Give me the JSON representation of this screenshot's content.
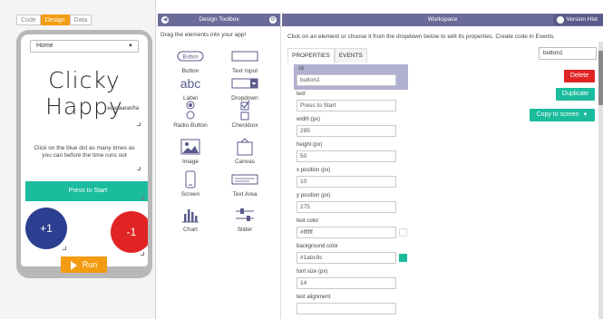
{
  "mode_tabs": [
    "Code",
    "Design",
    "Data"
  ],
  "screen": {
    "dropdown_value": "Home",
    "title": "Clicky Happy",
    "author": "ecasaarariha",
    "instructions": "Click on the blue dot as many times as you can before the time runs out",
    "start_button": "Press to Start",
    "blue_circle": "+1",
    "red_circle": "-1"
  },
  "run_button": "Run",
  "toolbox": {
    "header": "Design Toolbox",
    "hint": "Drag the elements into your app!",
    "items": [
      {
        "label": "Button",
        "icon": "button-icon",
        "glyph": "Button"
      },
      {
        "label": "Text Input",
        "icon": "text-input-icon"
      },
      {
        "label": "Label",
        "icon": "label-icon",
        "glyph": "abc"
      },
      {
        "label": "Dropdown",
        "icon": "dropdown-icon"
      },
      {
        "label": "Radio Button",
        "icon": "radio-button-icon"
      },
      {
        "label": "Checkbox",
        "icon": "checkbox-icon"
      },
      {
        "label": "Image",
        "icon": "image-icon"
      },
      {
        "label": "Canvas",
        "icon": "canvas-icon"
      },
      {
        "label": "Screen",
        "icon": "screen-icon"
      },
      {
        "label": "Text Area",
        "icon": "text-area-icon"
      },
      {
        "label": "Chart",
        "icon": "chart-icon"
      },
      {
        "label": "Slider",
        "icon": "slider-icon"
      }
    ]
  },
  "workspace": {
    "header": "Workspace",
    "version_button": "Version Hist",
    "hint": "Click on an element or choose it from the dropdown below to edit its properties. Create code in Events.",
    "tabs": [
      "PROPERTIES",
      "EVENTS"
    ],
    "element_select": "button1",
    "properties": [
      {
        "label": "id",
        "value": "button1"
      },
      {
        "label": "text",
        "value": "Press to Start"
      },
      {
        "label": "width (px)",
        "value": "295"
      },
      {
        "label": "height (px)",
        "value": "50"
      },
      {
        "label": "x position (px)",
        "value": "10"
      },
      {
        "label": "y position (px)",
        "value": "275"
      },
      {
        "label": "text color",
        "value": "#ffffff"
      },
      {
        "label": "background color",
        "value": "#1abc9c"
      },
      {
        "label": "font size (px)",
        "value": "14"
      },
      {
        "label": "text alignment",
        "value": ""
      }
    ],
    "delete_button": "Delete",
    "duplicate_button": "Duplicate",
    "copy_button": "Copy to screen"
  },
  "colors": {
    "accent_orange": "#f39c12",
    "teal": "#1abc9c",
    "header_purple": "#6b6b9a",
    "blue_dot": "#2c3e8f",
    "red_dot": "#e02424",
    "text_color_swatch": "#ffffff",
    "bg_color_swatch": "#1abc9c"
  }
}
